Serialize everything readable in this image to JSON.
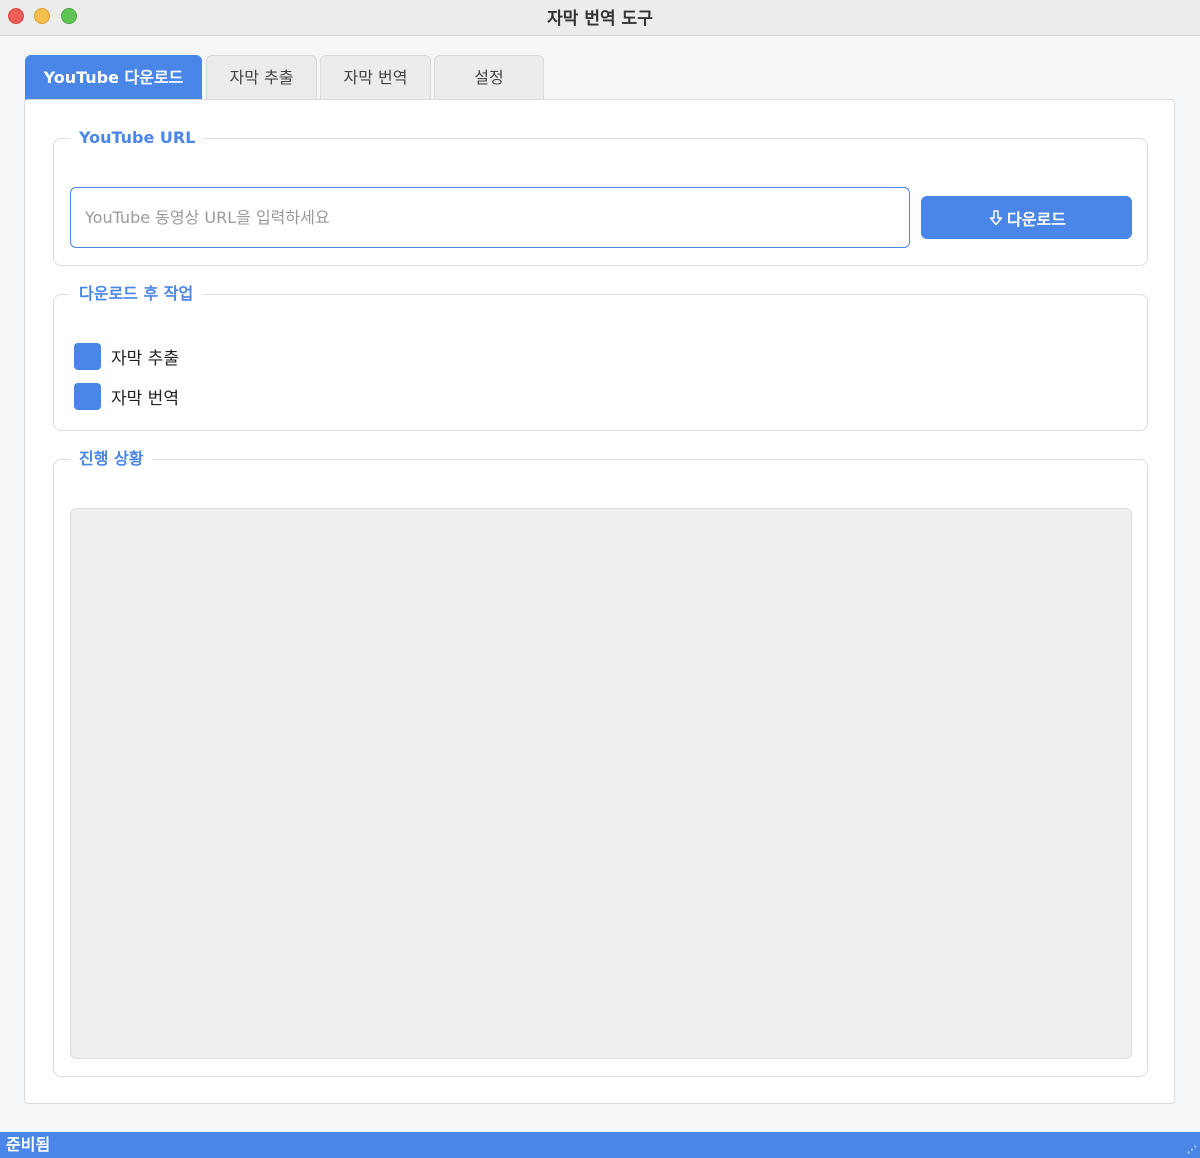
{
  "window": {
    "title": "자막 번역 도구"
  },
  "tabs": [
    {
      "label": "YouTube 다운로드",
      "active": true
    },
    {
      "label": "자막 추출",
      "active": false
    },
    {
      "label": "자막 번역",
      "active": false
    },
    {
      "label": "설정",
      "active": false
    }
  ],
  "url_group": {
    "title": "YouTube URL",
    "input_value": "",
    "input_placeholder": "YouTube 동영상 URL을 입력하세요",
    "download_button": {
      "icon": "arrow-down-icon",
      "label": "다운로드"
    }
  },
  "after_group": {
    "title": "다운로드 후 작업",
    "options": [
      {
        "label": "자막 추출",
        "checked": true
      },
      {
        "label": "자막 번역",
        "checked": true
      }
    ]
  },
  "progress_group": {
    "title": "진행 상황",
    "log_text": ""
  },
  "statusbar": {
    "text": "준비됨"
  },
  "colors": {
    "accent": "#4a86e8",
    "log_bg": "#efefef"
  }
}
